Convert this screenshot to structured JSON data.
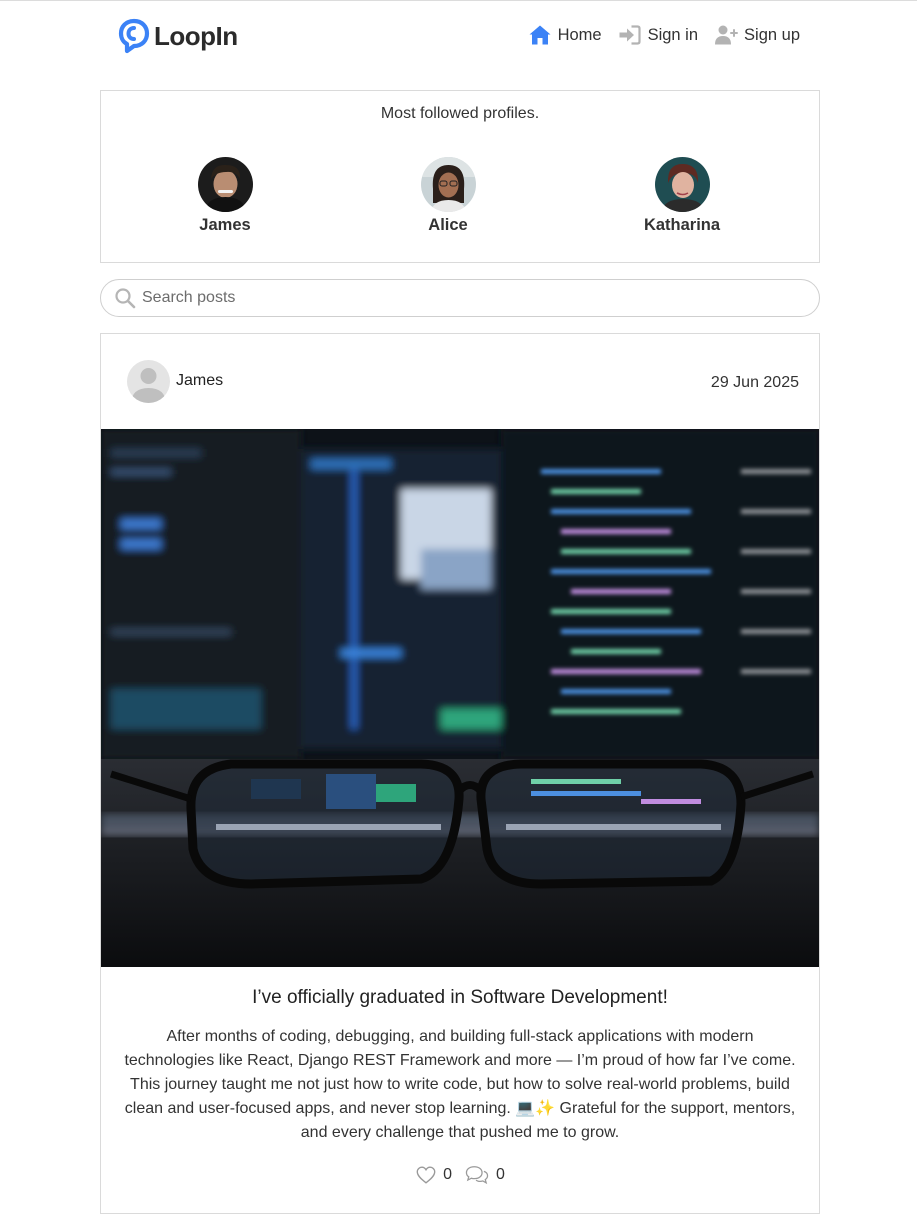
{
  "brand": {
    "name": "LoopIn",
    "color": "#3b82f6"
  },
  "nav": {
    "home_label": "Home",
    "signin_label": "Sign in",
    "signup_label": "Sign up",
    "home_icon": "house-icon",
    "signin_icon": "sign-in-icon",
    "signup_icon": "user-plus-icon"
  },
  "popular_profiles": {
    "title": "Most followed profiles.",
    "profiles": [
      {
        "name": "James"
      },
      {
        "name": "Alice"
      },
      {
        "name": "Katharina"
      }
    ]
  },
  "search": {
    "placeholder": "Search posts",
    "value": ""
  },
  "post": {
    "author": "James",
    "date": "29 Jun 2025",
    "title": "I’ve officially graduated in Software Development!",
    "body": "After months of coding, debugging, and building full-stack applications with modern technologies like React, Django REST Framework and more — I’m proud of how far I’ve come. This journey taught me not just how to write code, but how to solve real-world problems, build clean and user-focused apps, and never stop learning. 💻✨ Grateful for the support, mentors, and every challenge that pushed me to grow.",
    "likes": "0",
    "comments": "0",
    "like_icon": "heart-icon",
    "comment_icon": "comments-icon"
  }
}
